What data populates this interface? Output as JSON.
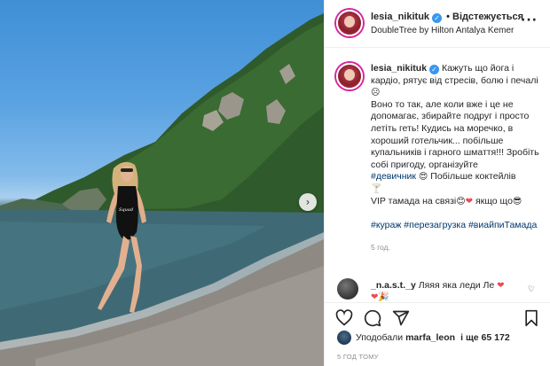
{
  "post": {
    "username": "lesia_nikituk",
    "follow_label": "• Відстежується",
    "location": "DoubleTree by Hilton Antalya Kemer",
    "caption": {
      "line1": "Кажуть що йога і кардіо, рятує від стресів, болю і печалі",
      "line2": "Воно то так, але коли вже і це не допомагає, збирайте подруг і просто летіть геть! Кудись на моречко, в хороший готельчик... побільше купальників і гарного шмаття!!! Зробіть собі пригоду, організуйте",
      "tag1": "#девичник",
      "line2b": "Побільше коктейлів",
      "line3": "VIP тамада на связі",
      "line3b": "якщо що",
      "tags": "#кураж #перезагрузка #виайпиТамада",
      "time": "5 год."
    },
    "comment": {
      "username": "_n.a.s.t._y",
      "text": "Ляяя яка леди Ле"
    },
    "likes": {
      "prefix": "Уподобали",
      "user": "marfa_leon",
      "suffix": "і ще 65 172"
    },
    "time_ago": "5 ГОД ТОМУ"
  },
  "icons": {
    "verified": "verified-badge-icon",
    "more": "more-options-icon",
    "like": "heart-icon",
    "comment": "comment-icon",
    "share": "paper-plane-icon",
    "save": "bookmark-icon",
    "next": "chevron-right-icon"
  },
  "colors": {
    "verified": "#3897f0",
    "hashtag": "#00376b",
    "heart": "#ed4956",
    "muted": "#8e8e8e"
  }
}
